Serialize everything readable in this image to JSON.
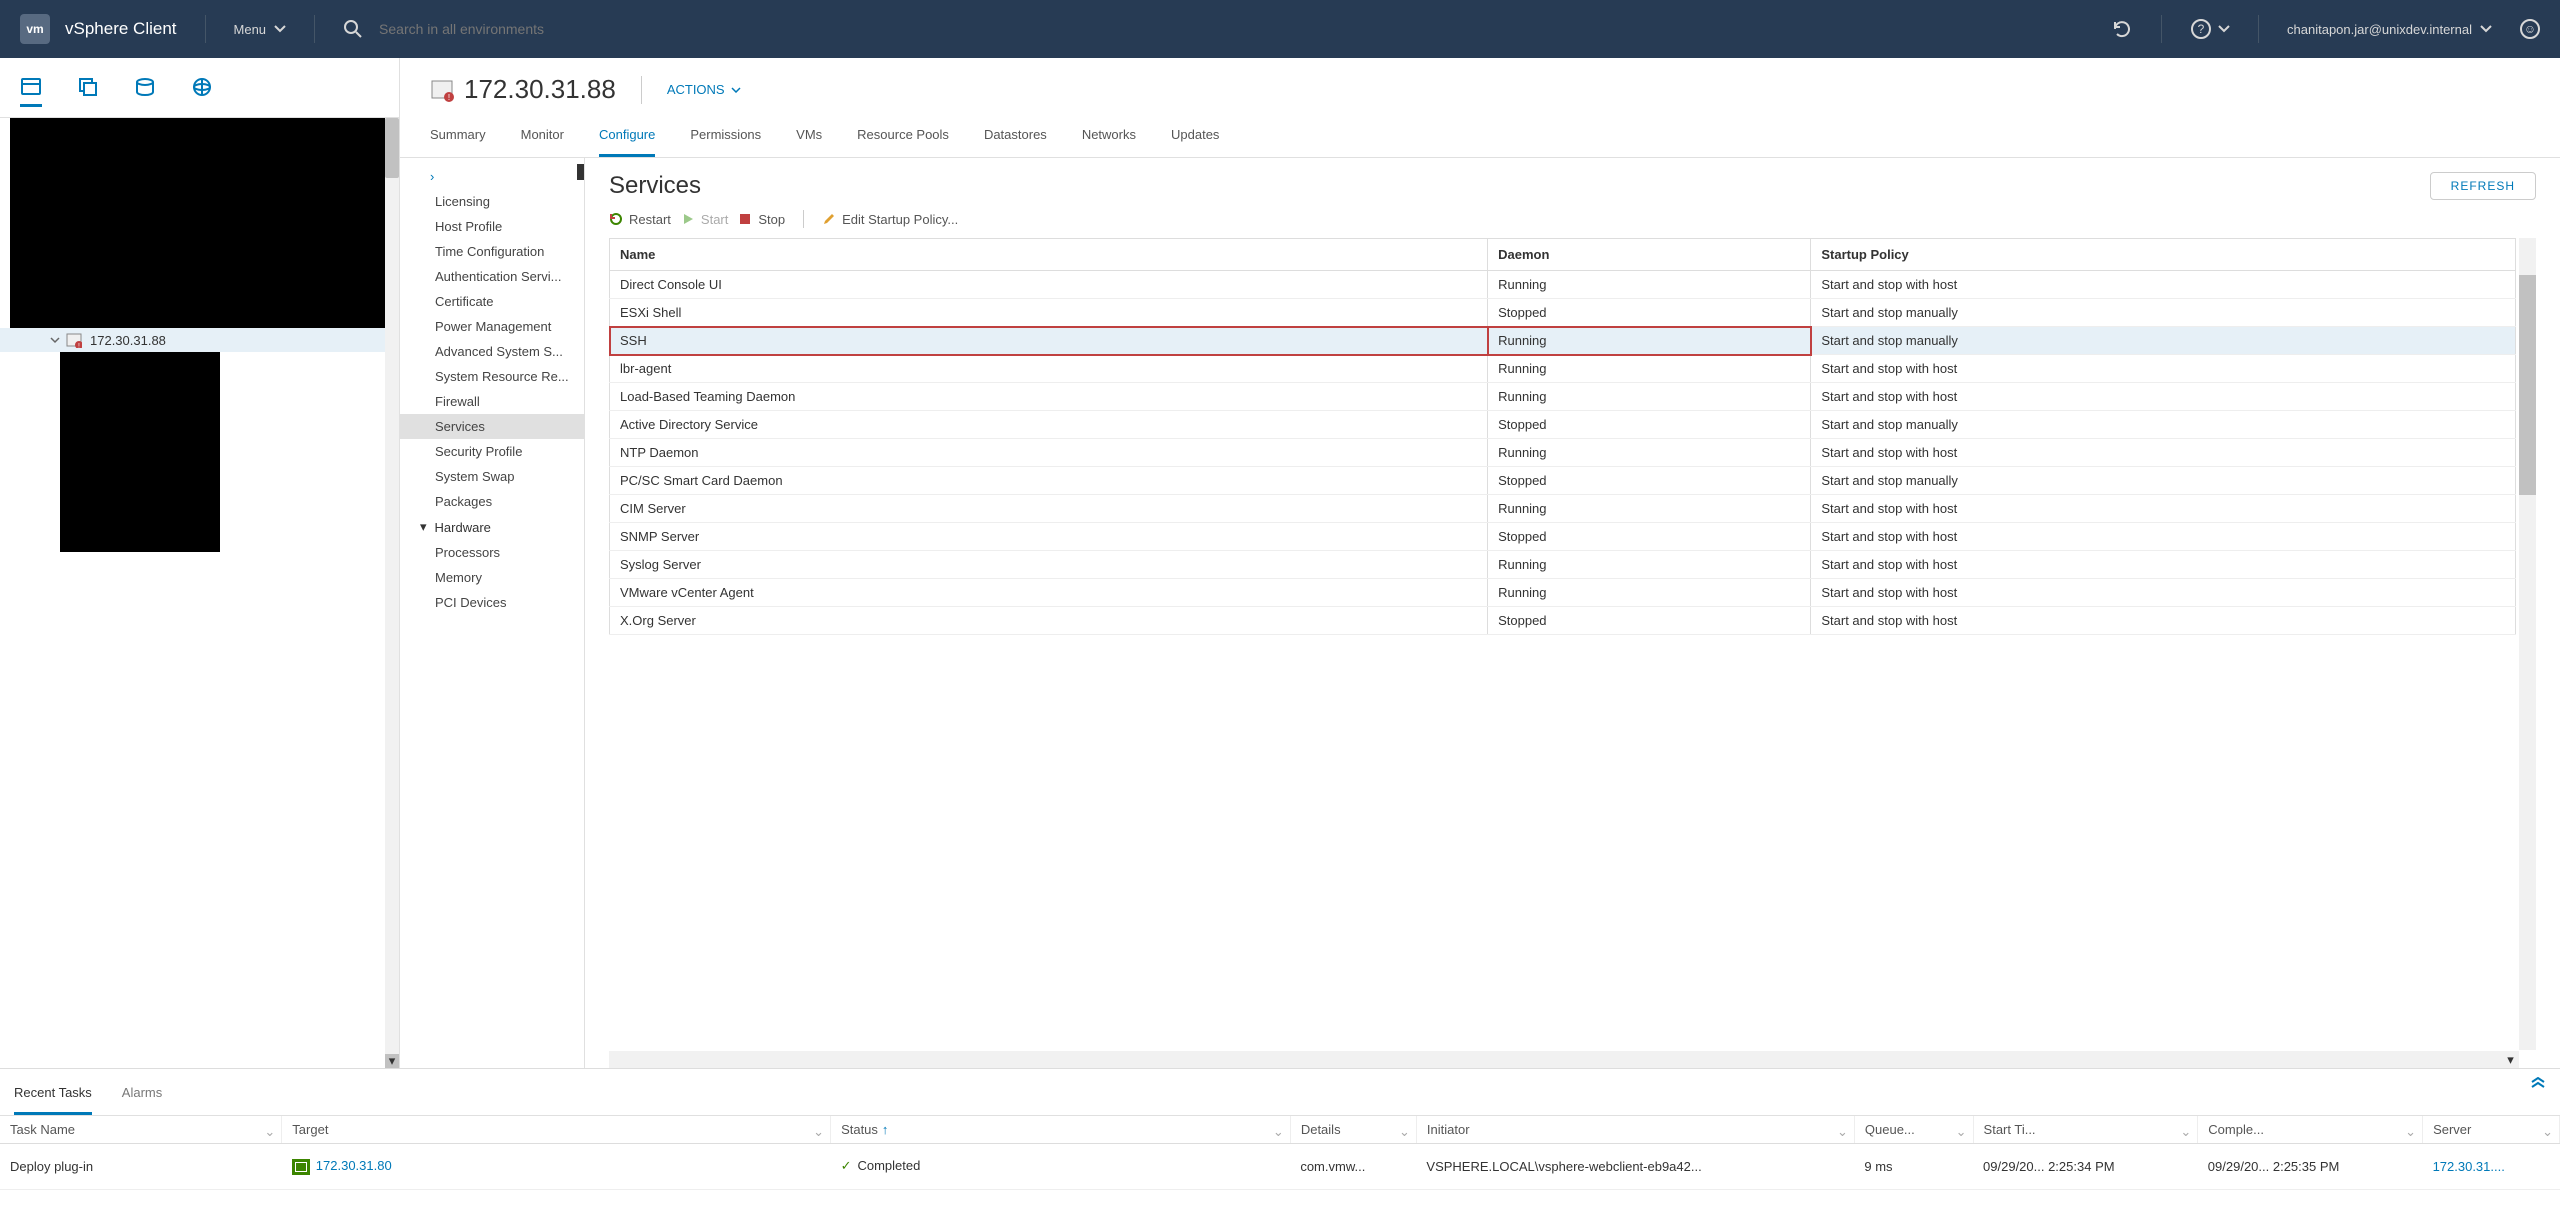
{
  "header": {
    "app_title": "vSphere Client",
    "menu_label": "Menu",
    "search_placeholder": "Search in all environments",
    "user": "chanitapon.jar@unixdev.internal"
  },
  "tree": {
    "selected_host": "172.30.31.88"
  },
  "object": {
    "title": "172.30.31.88",
    "actions_label": "ACTIONS",
    "tabs": [
      "Summary",
      "Monitor",
      "Configure",
      "Permissions",
      "VMs",
      "Resource Pools",
      "Datastores",
      "Networks",
      "Updates"
    ],
    "active_tab": "Configure"
  },
  "config_nav": {
    "items_top": [
      "Licensing",
      "Host Profile",
      "Time Configuration",
      "Authentication Servi...",
      "Certificate",
      "Power Management",
      "Advanced System S...",
      "System Resource Re...",
      "Firewall",
      "Services",
      "Security Profile",
      "System Swap",
      "Packages"
    ],
    "heading": "Hardware",
    "items_bottom": [
      "Processors",
      "Memory",
      "PCI Devices"
    ],
    "selected": "Services"
  },
  "services": {
    "title": "Services",
    "refresh": "REFRESH",
    "toolbar": {
      "restart": "Restart",
      "start": "Start",
      "stop": "Stop",
      "edit": "Edit Startup Policy..."
    },
    "columns": [
      "Name",
      "Daemon",
      "Startup Policy"
    ],
    "rows": [
      {
        "name": "Direct Console UI",
        "daemon": "Running",
        "policy": "Start and stop with host"
      },
      {
        "name": "ESXi Shell",
        "daemon": "Stopped",
        "policy": "Start and stop manually"
      },
      {
        "name": "SSH",
        "daemon": "Running",
        "policy": "Start and stop manually",
        "selected": true,
        "highlighted": true
      },
      {
        "name": "lbr-agent",
        "daemon": "Running",
        "policy": "Start and stop with host"
      },
      {
        "name": "Load-Based Teaming Daemon",
        "daemon": "Running",
        "policy": "Start and stop with host"
      },
      {
        "name": "Active Directory Service",
        "daemon": "Stopped",
        "policy": "Start and stop manually"
      },
      {
        "name": "NTP Daemon",
        "daemon": "Running",
        "policy": "Start and stop with host"
      },
      {
        "name": "PC/SC Smart Card Daemon",
        "daemon": "Stopped",
        "policy": "Start and stop manually"
      },
      {
        "name": "CIM Server",
        "daemon": "Running",
        "policy": "Start and stop with host"
      },
      {
        "name": "SNMP Server",
        "daemon": "Stopped",
        "policy": "Start and stop with host"
      },
      {
        "name": "Syslog Server",
        "daemon": "Running",
        "policy": "Start and stop with host"
      },
      {
        "name": "VMware vCenter Agent",
        "daemon": "Running",
        "policy": "Start and stop with host"
      },
      {
        "name": "X.Org Server",
        "daemon": "Stopped",
        "policy": "Start and stop with host"
      }
    ]
  },
  "bottom": {
    "tabs": [
      "Recent Tasks",
      "Alarms"
    ],
    "active": "Recent Tasks",
    "columns": [
      "Task Name",
      "Target",
      "Status",
      "Details",
      "Initiator",
      "Queue...",
      "Start Ti...",
      "Comple...",
      "Server"
    ],
    "sort_col": "Status",
    "row": {
      "task": "Deploy plug-in",
      "target": "172.30.31.80",
      "status": "Completed",
      "details": "com.vmw...",
      "initiator": "VSPHERE.LOCAL\\vsphere-webclient-eb9a42...",
      "queued": "9 ms",
      "start": "09/29/20... 2:25:34 PM",
      "complete": "09/29/20... 2:25:35 PM",
      "server": "172.30.31...."
    }
  }
}
